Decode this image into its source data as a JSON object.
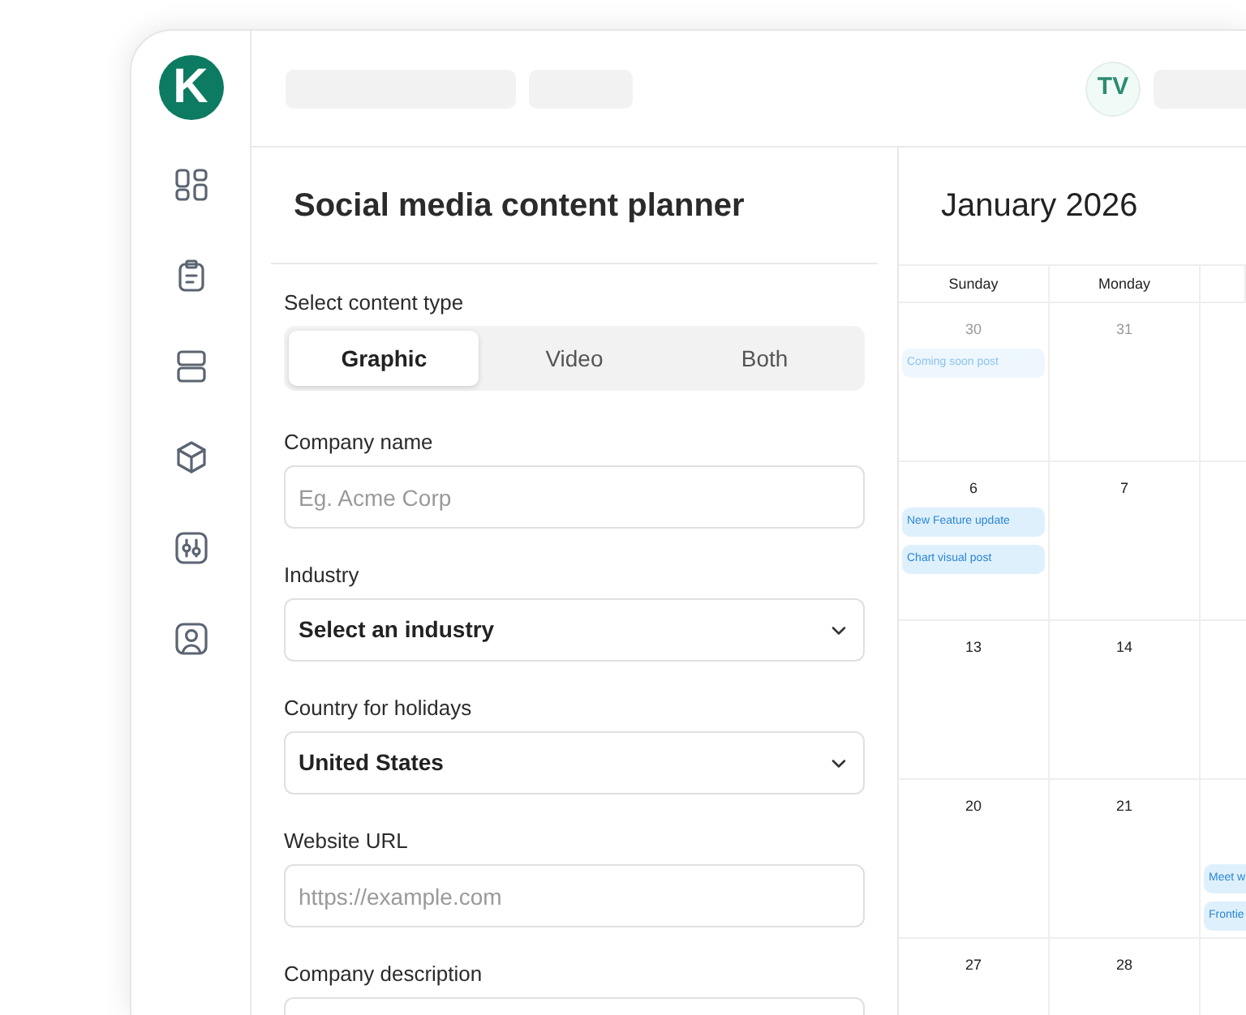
{
  "sidebar": {
    "logo": "K"
  },
  "topbar": {
    "avatar": "TV"
  },
  "form": {
    "title": "Social media content planner",
    "content_type": {
      "label": "Select content type",
      "options": [
        {
          "label": "Graphic",
          "selected": true
        },
        {
          "label": "Video",
          "selected": false
        },
        {
          "label": "Both",
          "selected": false
        }
      ]
    },
    "fields": [
      {
        "kind": "text",
        "label": "Company name",
        "placeholder": "Eg. Acme Corp"
      },
      {
        "kind": "select",
        "label": "Industry",
        "value": "Select an industry"
      },
      {
        "kind": "select",
        "label": "Country for holidays",
        "value": "United States"
      },
      {
        "kind": "text",
        "label": "Website URL",
        "placeholder": "https://example.com"
      },
      {
        "kind": "textarea",
        "label": "Company description"
      }
    ]
  },
  "calendar": {
    "title": "January 2026",
    "weekdays": [
      "Sunday",
      "Monday"
    ],
    "weeks": [
      {
        "days": [
          {
            "date": "30",
            "muted": true,
            "events": [
              {
                "title": "Coming soon post",
                "muted": true
              }
            ]
          },
          {
            "date": "31",
            "muted": true
          }
        ]
      },
      {
        "days": [
          {
            "date": "6",
            "muted": false,
            "events": [
              {
                "title": "New Feature update",
                "muted": false
              },
              {
                "title": "Chart visual post",
                "muted": false
              }
            ]
          },
          {
            "date": "7",
            "muted": false
          }
        ]
      },
      {
        "days": [
          {
            "date": "13",
            "muted": false
          },
          {
            "date": "14",
            "muted": false
          }
        ]
      },
      {
        "days": [
          {
            "date": "20",
            "muted": false
          },
          {
            "date": "21",
            "muted": false
          },
          {
            "events": [
              {
                "title": "Meet w",
                "muted": false
              },
              {
                "title": "Frontie",
                "muted": false
              }
            ]
          }
        ]
      },
      {
        "days": [
          {
            "date": "27",
            "muted": false
          },
          {
            "date": "28",
            "muted": false
          }
        ]
      }
    ]
  }
}
